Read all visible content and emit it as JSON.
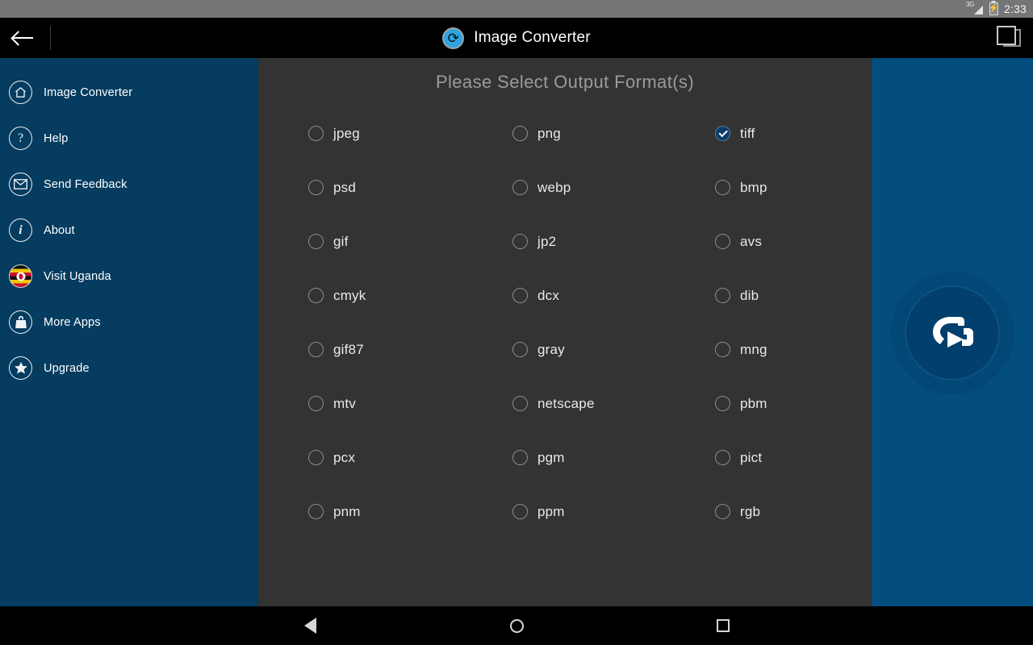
{
  "statusbar": {
    "network_label": "3G",
    "network_icon": "signal-3g-icon",
    "battery_icon": "battery-charging-icon",
    "clock": "2:33"
  },
  "appbar": {
    "back_icon": "back-arrow-icon",
    "logo_icon": "app-logo-convert-icon",
    "title": "Image Converter",
    "right_icon": "multi-window-icon"
  },
  "sidebar": {
    "background_color": "#053c60",
    "items": [
      {
        "label": "Image Converter",
        "icon": "home-icon"
      },
      {
        "label": "Help",
        "icon": "question-mark-icon"
      },
      {
        "label": "Send Feedback",
        "icon": "envelope-icon"
      },
      {
        "label": "About",
        "icon": "info-icon"
      },
      {
        "label": "Visit Uganda",
        "icon": "uganda-flag-icon"
      },
      {
        "label": "More Apps",
        "icon": "shopping-bag-icon"
      },
      {
        "label": "Upgrade",
        "icon": "star-icon"
      }
    ]
  },
  "main": {
    "title": "Please Select Output Format(s)",
    "background_color": "#333333",
    "formats": [
      {
        "label": "jpeg",
        "checked": false
      },
      {
        "label": "png",
        "checked": false
      },
      {
        "label": "tiff",
        "checked": true
      },
      {
        "label": "psd",
        "checked": false
      },
      {
        "label": "webp",
        "checked": false
      },
      {
        "label": "bmp",
        "checked": false
      },
      {
        "label": "gif",
        "checked": false
      },
      {
        "label": "jp2",
        "checked": false
      },
      {
        "label": "avs",
        "checked": false
      },
      {
        "label": "cmyk",
        "checked": false
      },
      {
        "label": "dcx",
        "checked": false
      },
      {
        "label": "dib",
        "checked": false
      },
      {
        "label": "gif87",
        "checked": false
      },
      {
        "label": "gray",
        "checked": false
      },
      {
        "label": "mng",
        "checked": false
      },
      {
        "label": "mtv",
        "checked": false
      },
      {
        "label": "netscape",
        "checked": false
      },
      {
        "label": "pbm",
        "checked": false
      },
      {
        "label": "pcx",
        "checked": false
      },
      {
        "label": "pgm",
        "checked": false
      },
      {
        "label": "pict",
        "checked": false
      },
      {
        "label": "pnm",
        "checked": false
      },
      {
        "label": "ppm",
        "checked": false
      },
      {
        "label": "rgb",
        "checked": false
      }
    ]
  },
  "rightpane": {
    "background_color": "#034e7f",
    "fab_icon": "convert-arrow-icon"
  },
  "navbar": {
    "back_icon": "nav-back-triangle-icon",
    "home_icon": "nav-home-circle-icon",
    "recents_icon": "nav-recents-square-icon"
  },
  "colors": {
    "accent_blue": "#034e7f",
    "sidebar_blue": "#053c60",
    "checked_blue": "#0b3d67",
    "panel_gray": "#333333",
    "status_gray": "#757575"
  }
}
